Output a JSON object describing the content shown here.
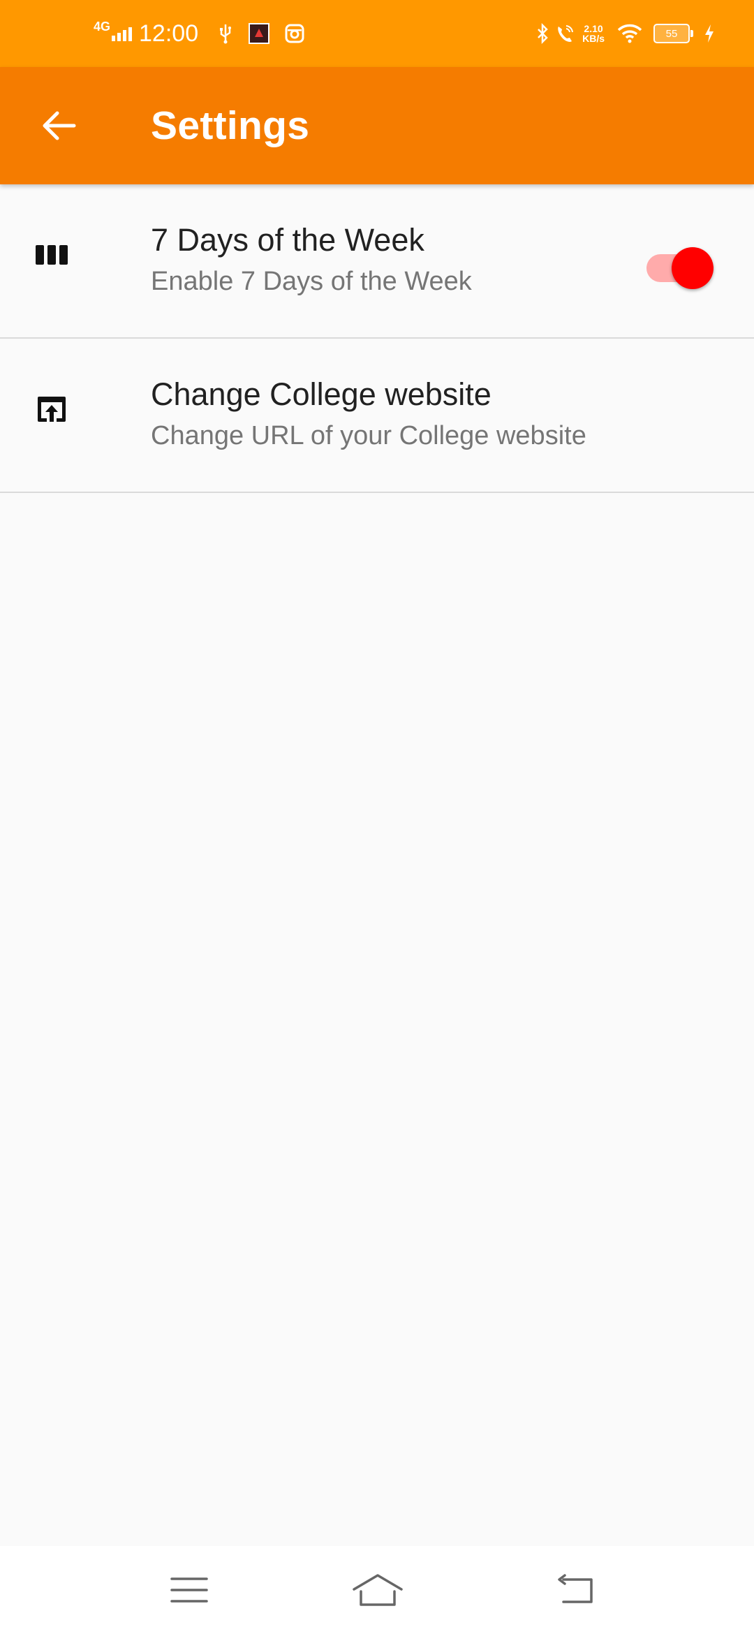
{
  "status_bar": {
    "network": "4G",
    "time": "12:00",
    "net_speed_value": "2.10",
    "net_speed_unit": "KB/s",
    "battery": "55"
  },
  "app_bar": {
    "title": "Settings",
    "background": "#f57c00"
  },
  "preferences": [
    {
      "title": "7 Days of the Week",
      "summary": "Enable 7 Days of the Week",
      "icon": "view-week-icon",
      "toggle": true
    },
    {
      "title": "Change College website",
      "summary": "Change URL of your College website",
      "icon": "open-in-browser-icon"
    }
  ],
  "colors": {
    "status_bar": "#ff9800",
    "switch_thumb": "#ff0000",
    "switch_track": "#ffabab"
  },
  "nav_bar": {
    "icons": [
      "menu-icon",
      "home-icon",
      "back-icon"
    ]
  }
}
